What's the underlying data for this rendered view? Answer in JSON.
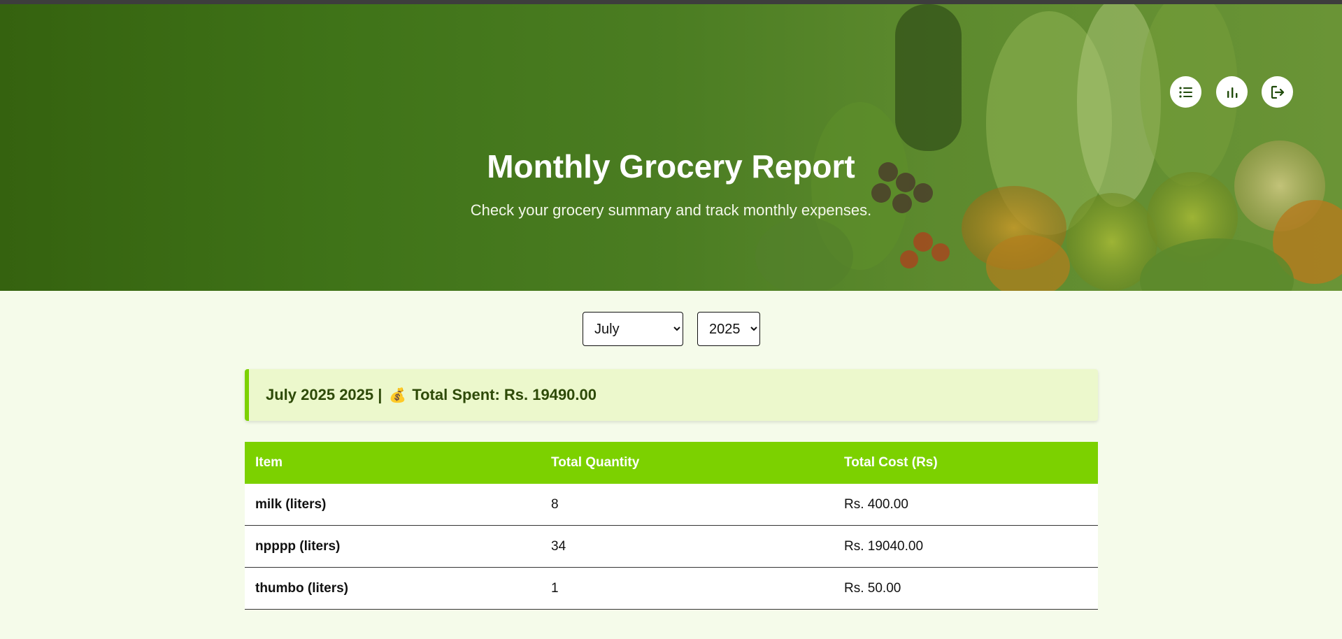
{
  "hero": {
    "title": "Monthly Grocery Report",
    "subtitle": "Check your grocery summary and track monthly expenses."
  },
  "nav_icons": [
    {
      "name": "list-icon"
    },
    {
      "name": "bar-chart-icon"
    },
    {
      "name": "logout-icon"
    }
  ],
  "filters": {
    "month": "July",
    "year": "2025"
  },
  "summary": {
    "period": "July 2025 2025 |",
    "emoji": "💰",
    "total_text": "Total Spent: Rs. 19490.00"
  },
  "table": {
    "headers": [
      "Item",
      "Total Quantity",
      "Total Cost (Rs)"
    ],
    "rows": [
      {
        "item": "milk (liters)",
        "quantity": "8",
        "cost": "Rs. 400.00"
      },
      {
        "item": "npppp (liters)",
        "quantity": "34",
        "cost": "Rs. 19040.00"
      },
      {
        "item": "thumbo (liters)",
        "quantity": "1",
        "cost": "Rs. 50.00"
      }
    ]
  },
  "colors": {
    "accent": "#7cd100",
    "hero_green": "#3f7318",
    "page_bg": "#f5fbea",
    "summary_bg": "#ecf8cc"
  }
}
